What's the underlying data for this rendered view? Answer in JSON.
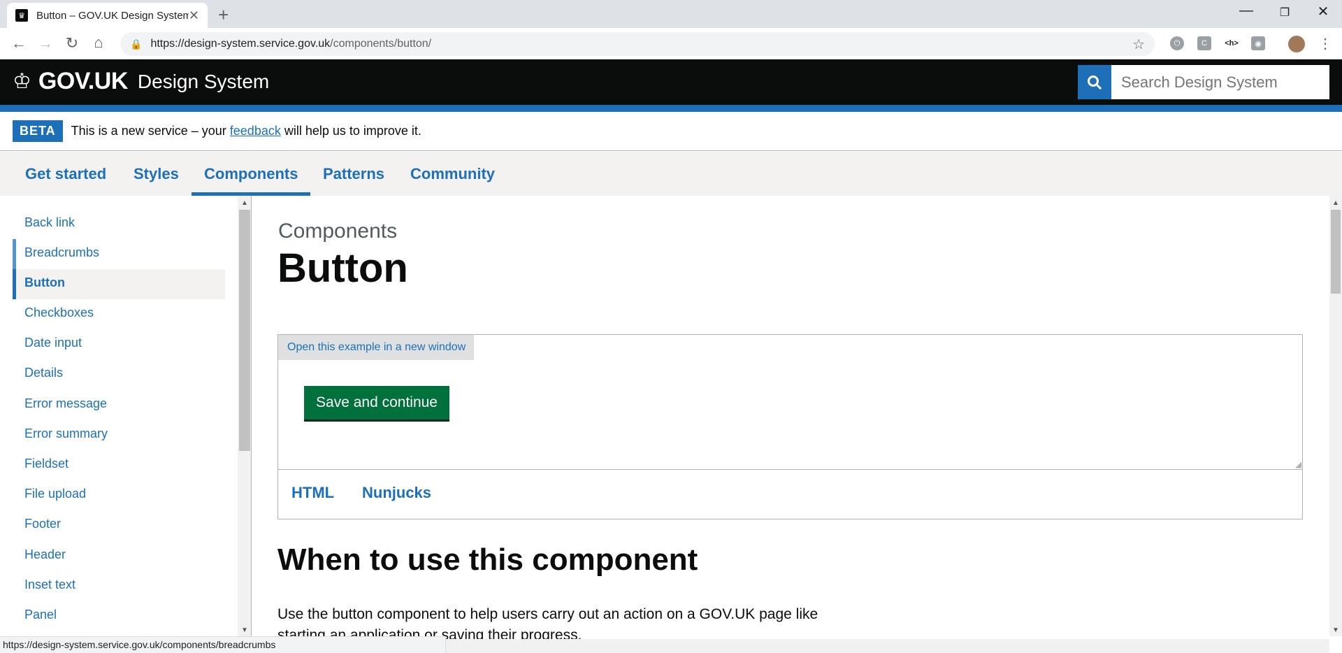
{
  "browser": {
    "tab_title": "Button – GOV.UK Design System",
    "url_host": "https://design-system.service.gov.uk",
    "url_path": "/components/button/",
    "status_url": "https://design-system.service.gov.uk/components/breadcrumbs"
  },
  "header": {
    "logo": "GOV.UK",
    "product": "Design System",
    "search_placeholder": "Search Design System"
  },
  "beta": {
    "tag": "BETA",
    "text_before": "This is a new service – your",
    "link": "feedback",
    "text_after": "will help us to improve it."
  },
  "nav": {
    "items": [
      {
        "label": "Get started"
      },
      {
        "label": "Styles"
      },
      {
        "label": "Components"
      },
      {
        "label": "Patterns"
      },
      {
        "label": "Community"
      }
    ],
    "active": "Components"
  },
  "sidebar": {
    "items": [
      {
        "label": "Back link"
      },
      {
        "label": "Breadcrumbs"
      },
      {
        "label": "Button"
      },
      {
        "label": "Checkboxes"
      },
      {
        "label": "Date input"
      },
      {
        "label": "Details"
      },
      {
        "label": "Error message"
      },
      {
        "label": "Error summary"
      },
      {
        "label": "Fieldset"
      },
      {
        "label": "File upload"
      },
      {
        "label": "Footer"
      },
      {
        "label": "Header"
      },
      {
        "label": "Inset text"
      },
      {
        "label": "Panel"
      }
    ],
    "active": "Button"
  },
  "main": {
    "caption": "Components",
    "title": "Button",
    "example": {
      "open_link": "Open this example in a new window",
      "button_label": "Save and continue",
      "tabs": [
        {
          "label": "HTML"
        },
        {
          "label": "Nunjucks"
        }
      ]
    },
    "section_title": "When to use this component",
    "paragraph": "Use the button component to help users carry out an action on a GOV.UK page like starting an application or saving their progress."
  },
  "colors": {
    "govuk_black": "#0b0c0c",
    "govuk_blue": "#1d70b8",
    "button_green": "#00703c"
  }
}
